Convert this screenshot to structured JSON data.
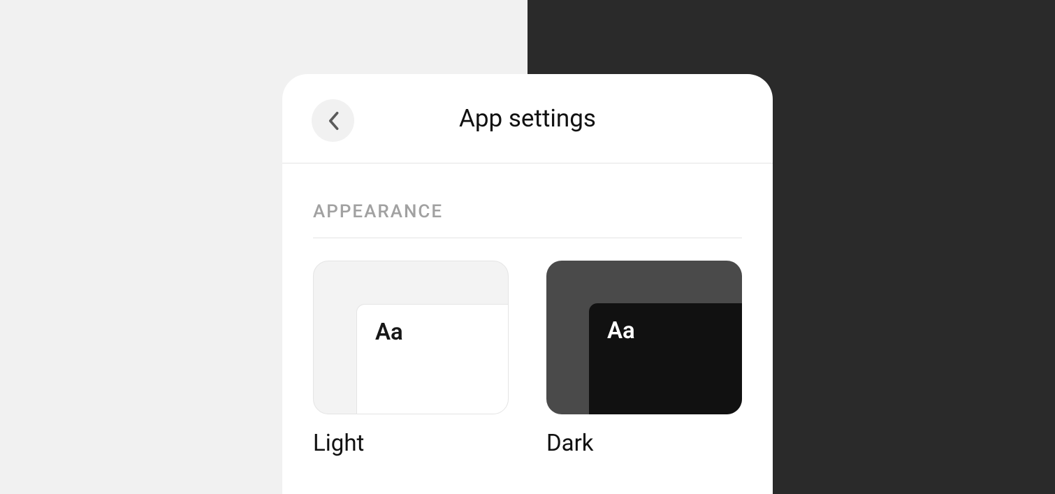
{
  "header": {
    "title": "App settings"
  },
  "section": {
    "label": "APPEARANCE"
  },
  "themes": {
    "sample_text": "Aa",
    "light": {
      "label": "Light"
    },
    "dark": {
      "label": "Dark"
    }
  }
}
